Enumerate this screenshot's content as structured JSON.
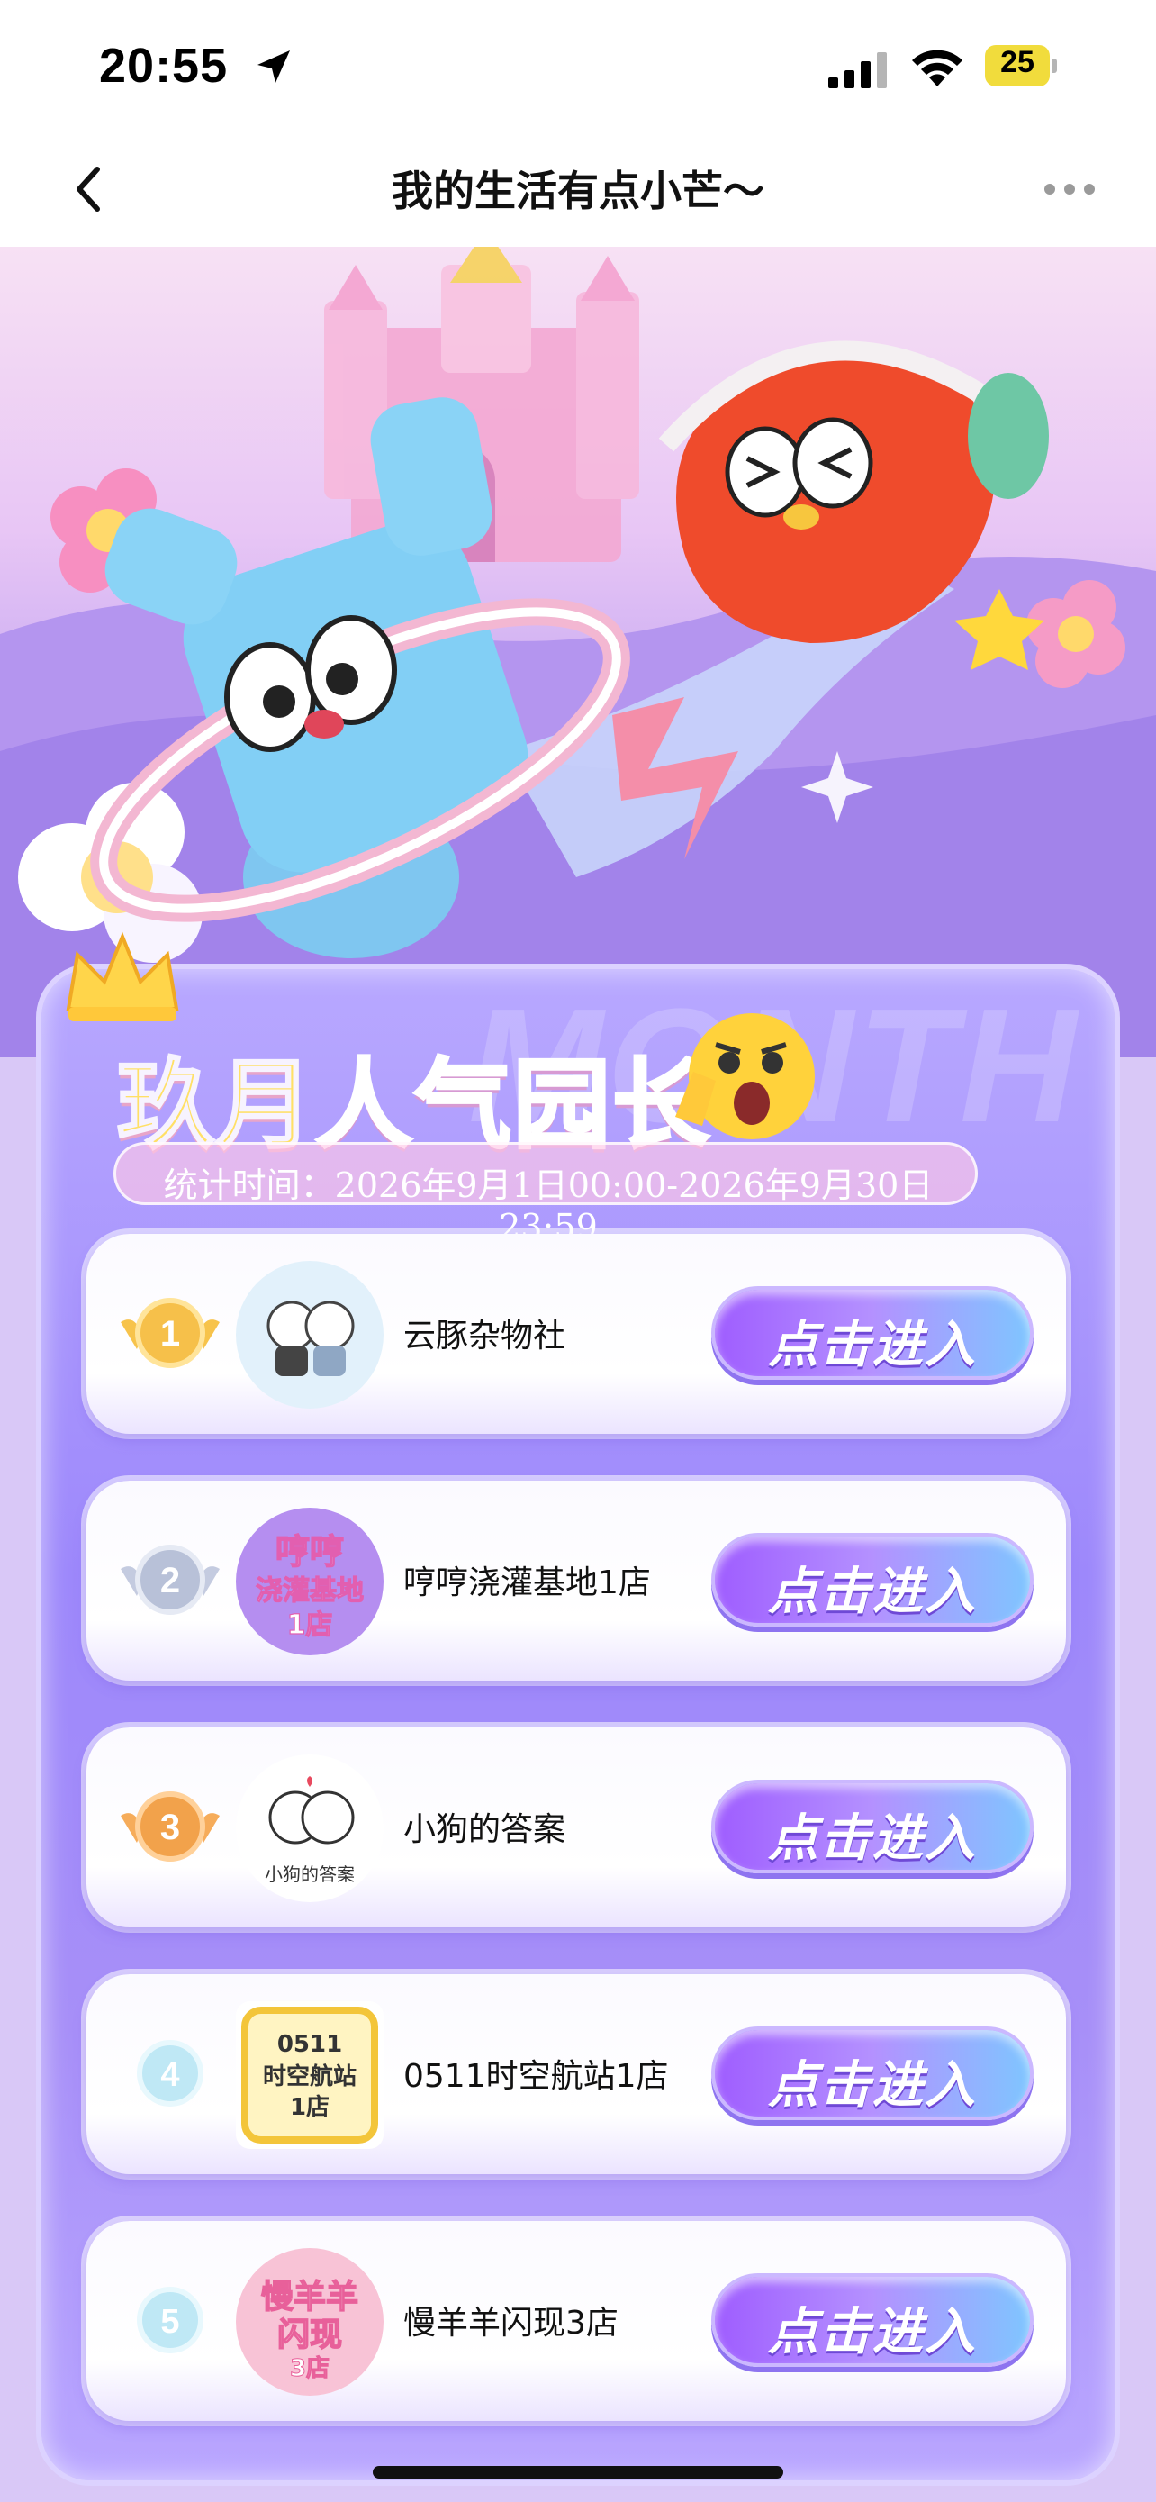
{
  "status_bar": {
    "time": "20:55",
    "battery": "25"
  },
  "nav": {
    "title": "我的生活有点小芒～"
  },
  "header": {
    "title_part1": "玖月",
    "title_part2": "人气园长",
    "bg_word": "MONTH",
    "stat_period": "统计时间：2026年9月1日00:00-2026年9月30日23:59"
  },
  "rows": [
    {
      "rank": "1",
      "name": "云豚杂物社",
      "button": "点击进入",
      "medal_color": "#f6c04a"
    },
    {
      "rank": "2",
      "name": "哼哼浇灌基地1店",
      "button": "点击进入",
      "medal_color": "#b8c1d8"
    },
    {
      "rank": "3",
      "name": "小狗的答案",
      "button": "点击进入",
      "medal_color": "#f2a24b"
    },
    {
      "rank": "4",
      "name": "0511时空航站1店",
      "button": "点击进入",
      "medal_color": "#bfe8f5"
    },
    {
      "rank": "5",
      "name": "慢羊羊闪现3店",
      "button": "点击进入",
      "medal_color": "#bfe8f5"
    }
  ],
  "avatars": {
    "a2_line1": "哼哼",
    "a2_line2": "浇灌基地",
    "a2_line3": "1店",
    "a3_caption": "小狗的答案",
    "a4_line1": "0511",
    "a4_line2": "时空航站",
    "a4_line3": "1店",
    "a5_line1": "慢羊羊",
    "a5_line2": "闪现",
    "a5_line3": "3店"
  },
  "colors": {
    "accent_purple": "#9d88fb",
    "button_start": "#9f5dff",
    "button_end": "#7fc5ff"
  }
}
